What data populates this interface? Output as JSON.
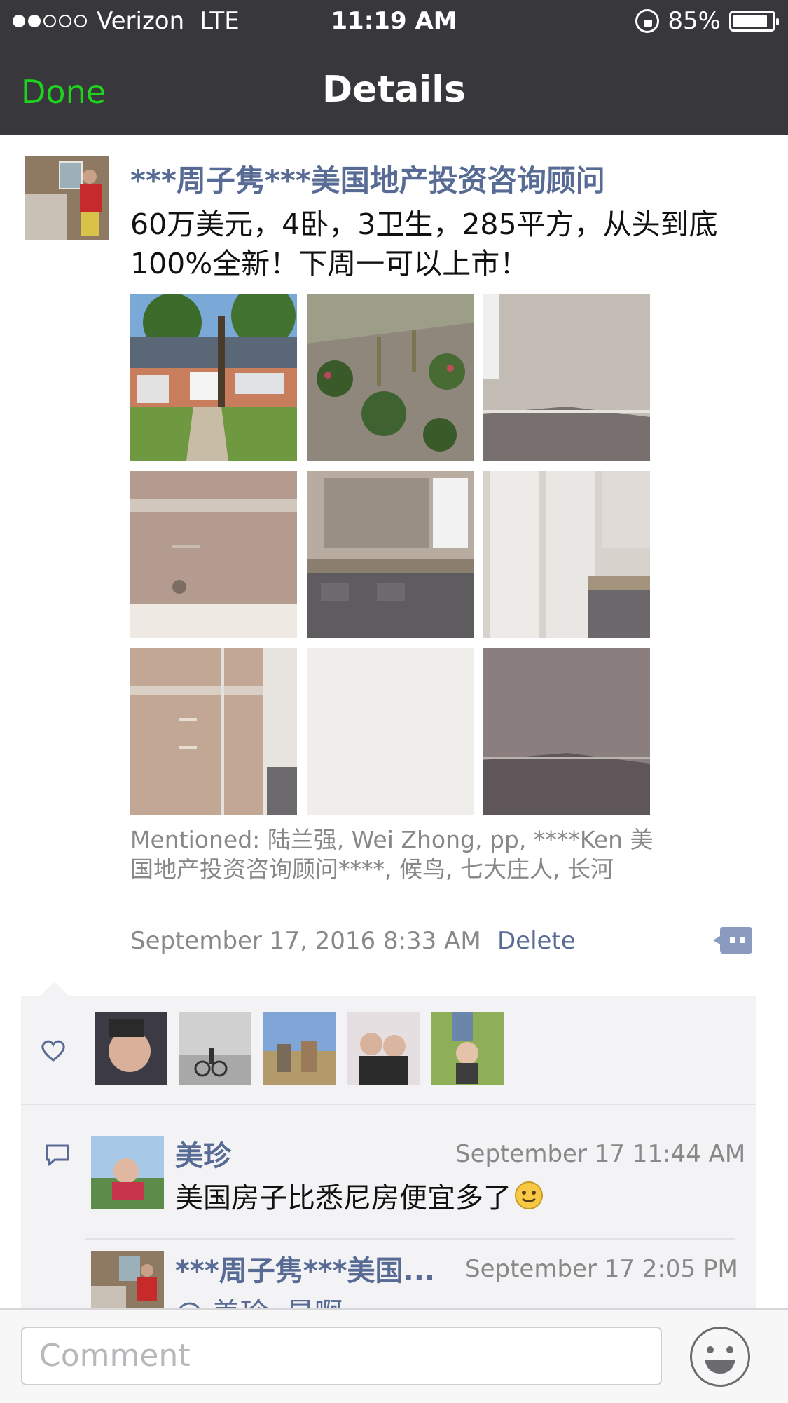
{
  "status_bar": {
    "carrier": "Verizon",
    "network": "LTE",
    "time": "11:19 AM",
    "battery": "85%"
  },
  "nav": {
    "done_label": "Done",
    "title": "Details"
  },
  "post": {
    "author": "***周子隽***美国地产投资咨询顾问",
    "content": "60万美元，4卧，3卫生，285平方，从头到底100%全新！下周一可以上市！",
    "mentioned": "Mentioned: 陆兰强, Wei Zhong, pp, ****Ken 美国地产投资咨询顾问****, 候鸟, 七大庄人, 长河",
    "timestamp": "September 17, 2016 8:33 AM",
    "delete_label": "Delete"
  },
  "comments": [
    {
      "name": "美珍",
      "time": "September 17 11:44 AM",
      "text": "美国房子比悉尼房便宜多了"
    },
    {
      "name": "***周子隽***美国...",
      "time": "September 17 2:05 PM",
      "text": "@ 美珍: 是啊"
    }
  ],
  "footer": {
    "comment_placeholder": "Comment"
  },
  "icons": {
    "like": "heart-icon",
    "comment": "comment-bubble-icon",
    "emoji": "smiley-icon",
    "more": "more-options-icon"
  },
  "colors": {
    "link": "#576b95",
    "done": "#1dd31d",
    "bar": "#38373c"
  }
}
